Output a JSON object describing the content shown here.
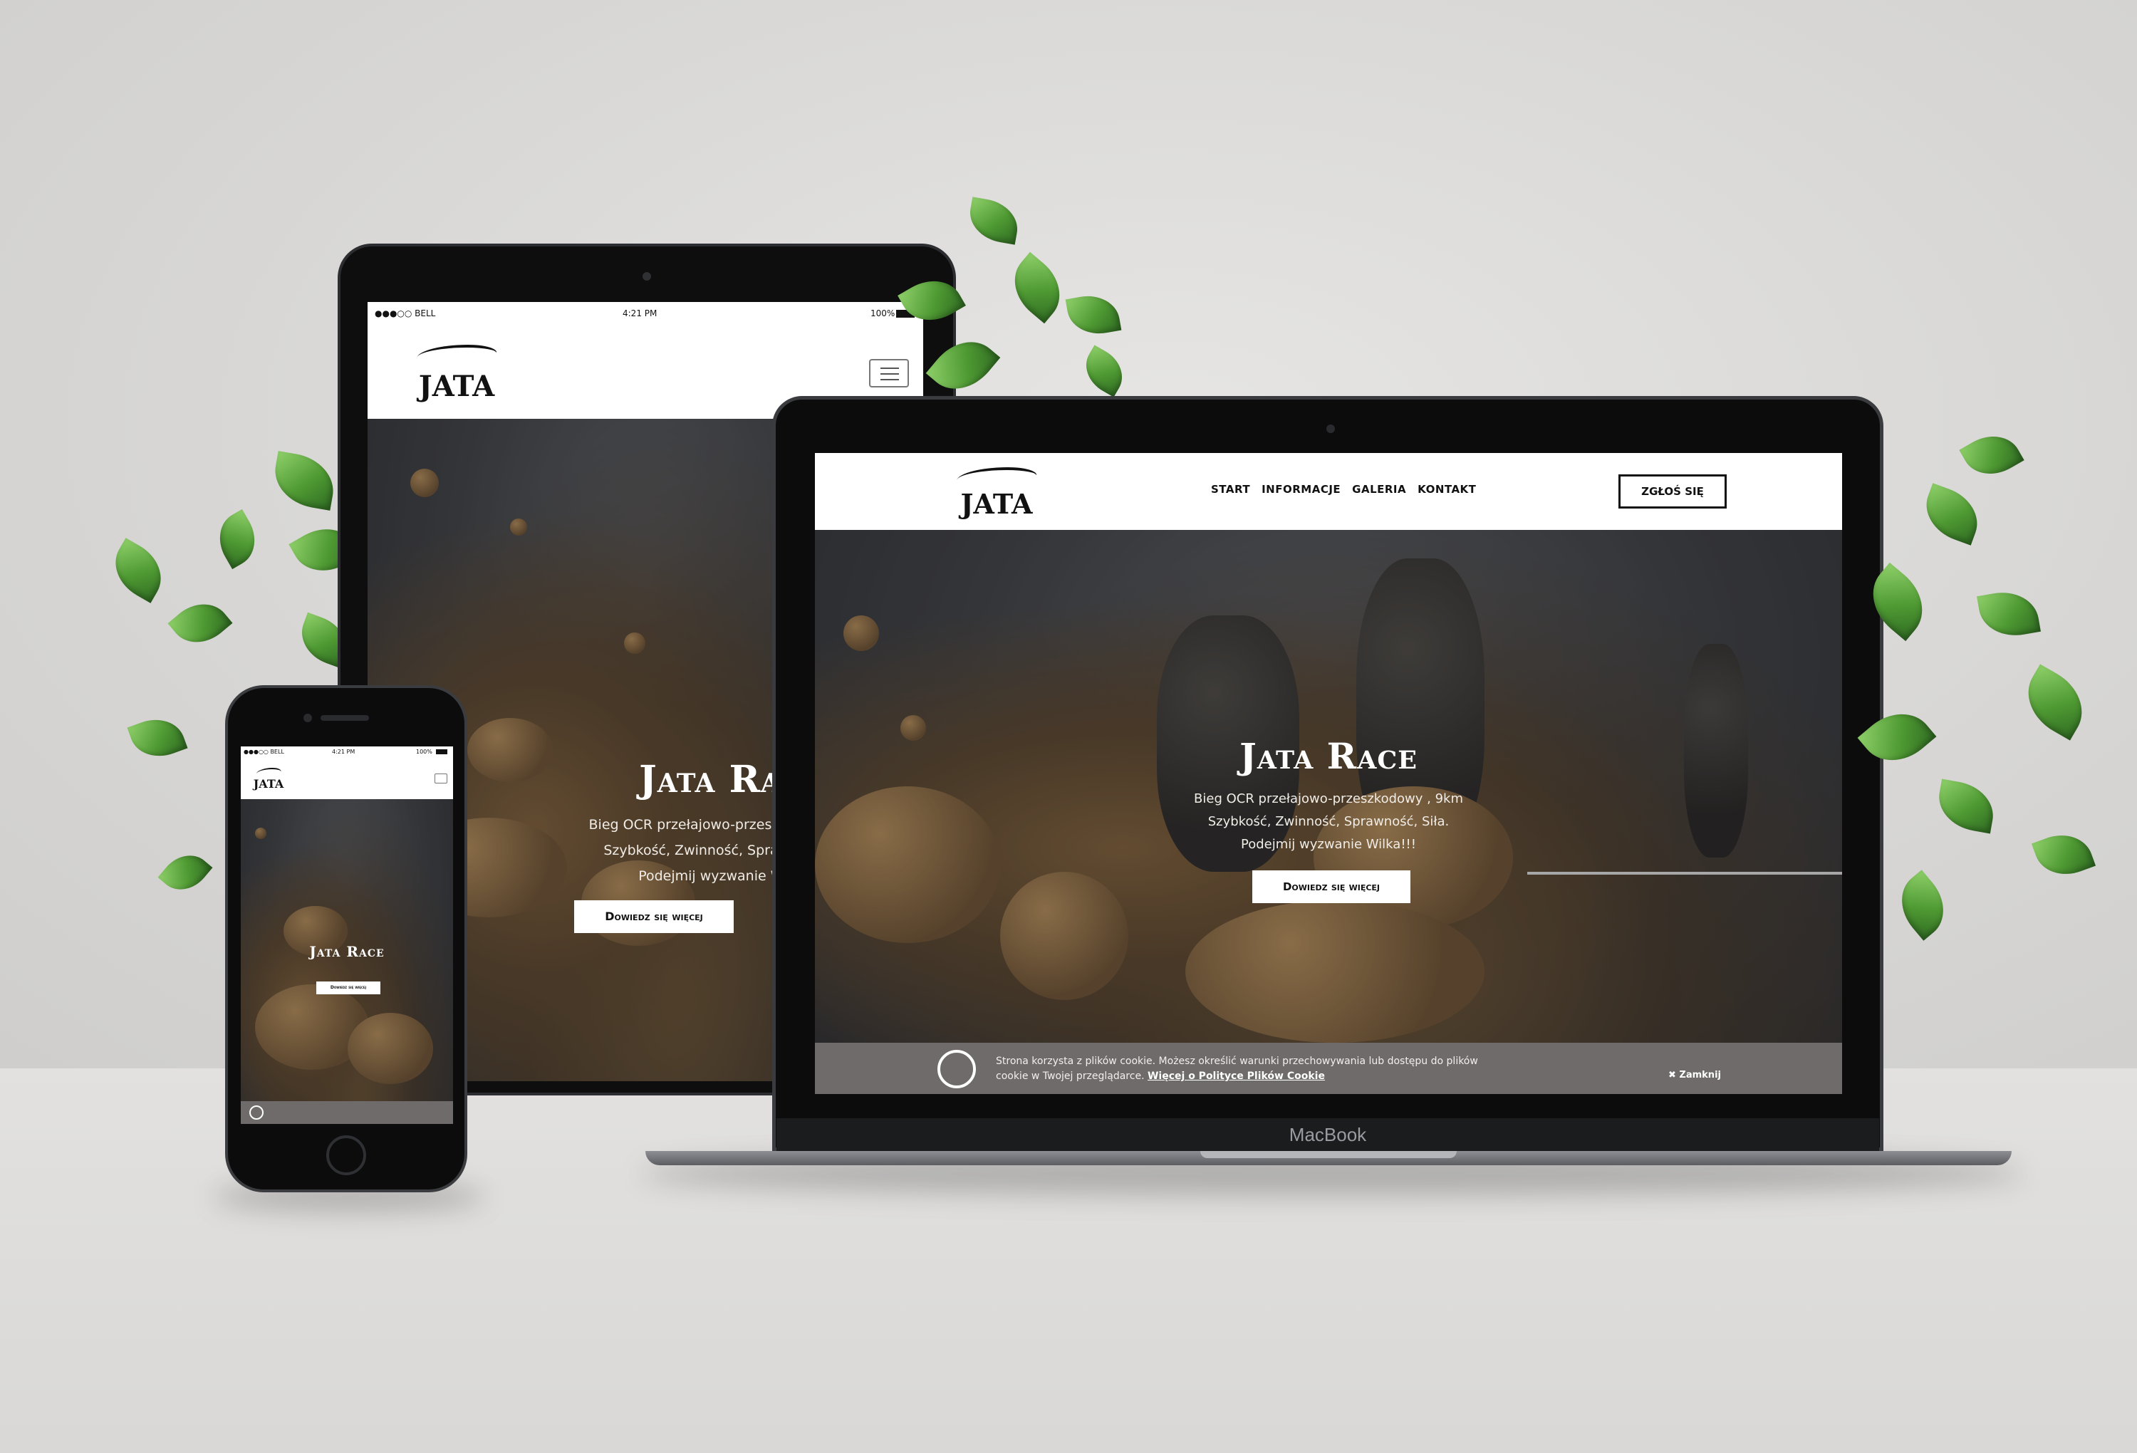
{
  "site": {
    "logo_text": "JATA",
    "nav": [
      "START",
      "INFORMACJE",
      "GALERIA",
      "KONTAKT"
    ],
    "cta_label": "ZGŁOŚ SIĘ",
    "hero": {
      "title": "Jata Race",
      "line1": "Bieg OCR przełajowo-przeszkodowy , 9km",
      "line2": "Szybkość, Zwinność, Sprawność, Siła.",
      "line3": "Podejmij wyzwanie Wilka!!!",
      "button": "Dowiedz się więcej"
    },
    "cookie": {
      "text": "Strona korzysta z plików cookie. Możesz określić warunki przechowywania lub dostępu do plików cookie w Twojej przeglądarce.",
      "link": "Więcej o Polityce Plików Cookie",
      "close": "Zamknij"
    }
  },
  "laptop": {
    "brand": "MacBook"
  },
  "tablet_status": {
    "carrier": "●●●○○ BELL",
    "time": "4:21 PM",
    "battery": "100%"
  },
  "phone_status": {
    "carrier": "●●●○○ BELL",
    "time": "4:21 PM",
    "battery": "100%"
  },
  "colors": {
    "cookie_bar": "#6e6b6a",
    "leaf": "#4f9a33"
  },
  "icons": {
    "cookie": "cookie-icon",
    "menu": "hamburger-menu-icon",
    "wifi": "wifi-icon",
    "battery": "battery-icon"
  }
}
